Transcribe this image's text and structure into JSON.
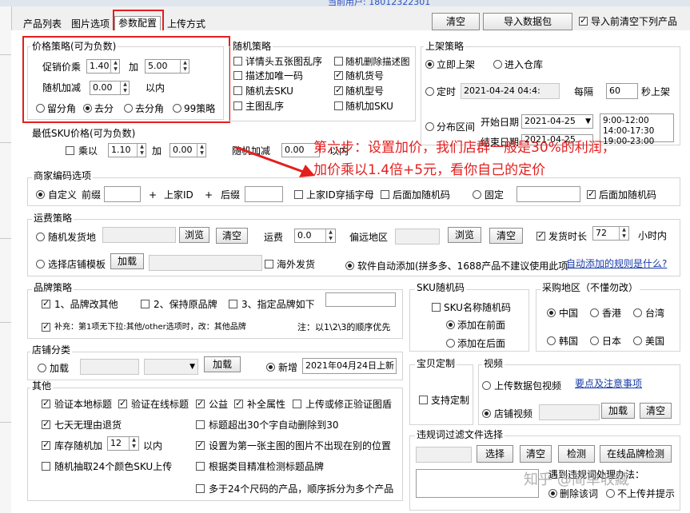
{
  "window": {
    "title_partial": "当前用户: 18012322301"
  },
  "tabs": [
    "产品列表",
    "图片选项",
    "参数配置",
    "上传方式"
  ],
  "toolbar": {
    "clear": "清空",
    "import": "导入数据包",
    "clear_before_import": "导入前清空下列产品"
  },
  "price": {
    "title": "价格策略(可为负数)",
    "promo_label": "促销价乘",
    "promo_value": "1.40",
    "add_label": "加",
    "add_value": "5.00",
    "random_label": "随机加减",
    "random_value": "0.00",
    "within": "以内",
    "rounding": [
      "留分角",
      "去分",
      "去分角",
      "99策略"
    ]
  },
  "random": {
    "title": "随机策略",
    "items": [
      "详情头五张图乱序",
      "随机删除描述图",
      "描述加唯一码",
      "随机货号",
      "随机去SKU",
      "随机型号",
      "主图乱序",
      "随机加SKU"
    ]
  },
  "publish": {
    "title": "上架策略",
    "now": "立即上架",
    "warehouse": "进入仓库",
    "timed": "定时",
    "timed_value": "2021-04-24 04:4:",
    "interval": "每隔",
    "interval_value": "60",
    "sec": "秒上架",
    "range": "分布区间",
    "start_label": "开始日期",
    "start_value": "2021-04-25",
    "end_label": "结束日期",
    "end_value": "2021-04-25",
    "slots": [
      "9:00-12:00",
      "14:00-17:30",
      "19:00-23:00"
    ]
  },
  "sku_price": {
    "title": "最低SKU价格(可为负数)",
    "mult": "乘以",
    "mult_value": "1.10",
    "add": "加",
    "add_value": "0.00",
    "random": "随机加减",
    "random_value": "0.00",
    "within": "以内"
  },
  "annotation": {
    "line1": "第六步：设置加价，我们店群一般是30%的利润，",
    "line2": "加价乘以1.4倍+5元，看你自己的定价"
  },
  "merchant": {
    "title": "商家编码选项",
    "custom": "自定义",
    "prefix": "前缀",
    "plus": "+",
    "shop_id": "上家ID",
    "suffix": "后缀",
    "interleave": "上家ID穿插字母",
    "add_random": "后面加随机码",
    "fixed": "固定",
    "add_random2": "后面加随机码"
  },
  "shipping": {
    "title": "运费策略",
    "random_place": "随机发货地",
    "browse": "浏览",
    "clear": "清空",
    "freight": "运费",
    "freight_value": "0.0",
    "remote": "偏远地区",
    "browse2": "浏览",
    "clear2": "清空",
    "ship_time": "发货时长",
    "ship_time_value": "72",
    "hours": "小时内",
    "template": "选择店铺模板",
    "load": "加载",
    "overseas": "海外发货",
    "auto": "软件自动添加(拼多多、1688产品不建议使用此项",
    "auto_link": "自动添加的规则是什么?"
  },
  "brand": {
    "title": "品牌策略",
    "opt1": "1、品牌改其他",
    "opt2": "2、保持原品牌",
    "opt3": "3、指定品牌如下",
    "note": "补充：第1项无下拉:其他/other选项时，改：其他品牌",
    "note2": "注：以1\\2\\3的顺序优先"
  },
  "sku_code": {
    "title": "SKU随机码",
    "name_random": "SKU名称随机码",
    "front": "添加在前面",
    "back": "添加在后面"
  },
  "region": {
    "title": "采购地区（不懂勿改）",
    "items": [
      "中国",
      "香港",
      "台湾",
      "韩国",
      "日本",
      "美国"
    ]
  },
  "shop_cat": {
    "title": "店铺分类",
    "load": "加载",
    "load_btn": "加载",
    "new": "新增",
    "new_value": "2021年04月24日上新"
  },
  "custom": {
    "title": "宝贝定制",
    "support": "支持定制"
  },
  "video": {
    "title": "视频",
    "upload": "上传数据包视频",
    "notice_link": "要点及注意事项",
    "shop_video": "店铺视频",
    "load": "加载",
    "clear": "清空"
  },
  "other": {
    "title": "其他",
    "verify_local": "验证本地标题",
    "verify_online": "验证在线标题",
    "public": "公益",
    "supplement": "补全属性",
    "upload_fix": "上传或修正验证图盾",
    "no_reason": "七天无理由退货",
    "title_over": "标题超出30个字自动删除到30",
    "stock_add": "库存随机加",
    "stock_value": "12",
    "within": "以内",
    "first_image": "设置为第一张主图的图片不出现在别的位置",
    "random24": "随机抽取24个颜色SKU上传",
    "brand_detect": "根据类目精准检测标题品牌",
    "split24": "多于24个尺码的产品，顺序拆分为多个产品"
  },
  "violation": {
    "title": "违规词过滤文件选择",
    "select": "选择",
    "clear": "清空",
    "check": "检测",
    "online_brand": "在线品牌检测",
    "handle": "遇到违规词处理办法：",
    "delete": "删除该词",
    "skip": "不上传并提示"
  },
  "watermark": "知乎 @简单收藏"
}
